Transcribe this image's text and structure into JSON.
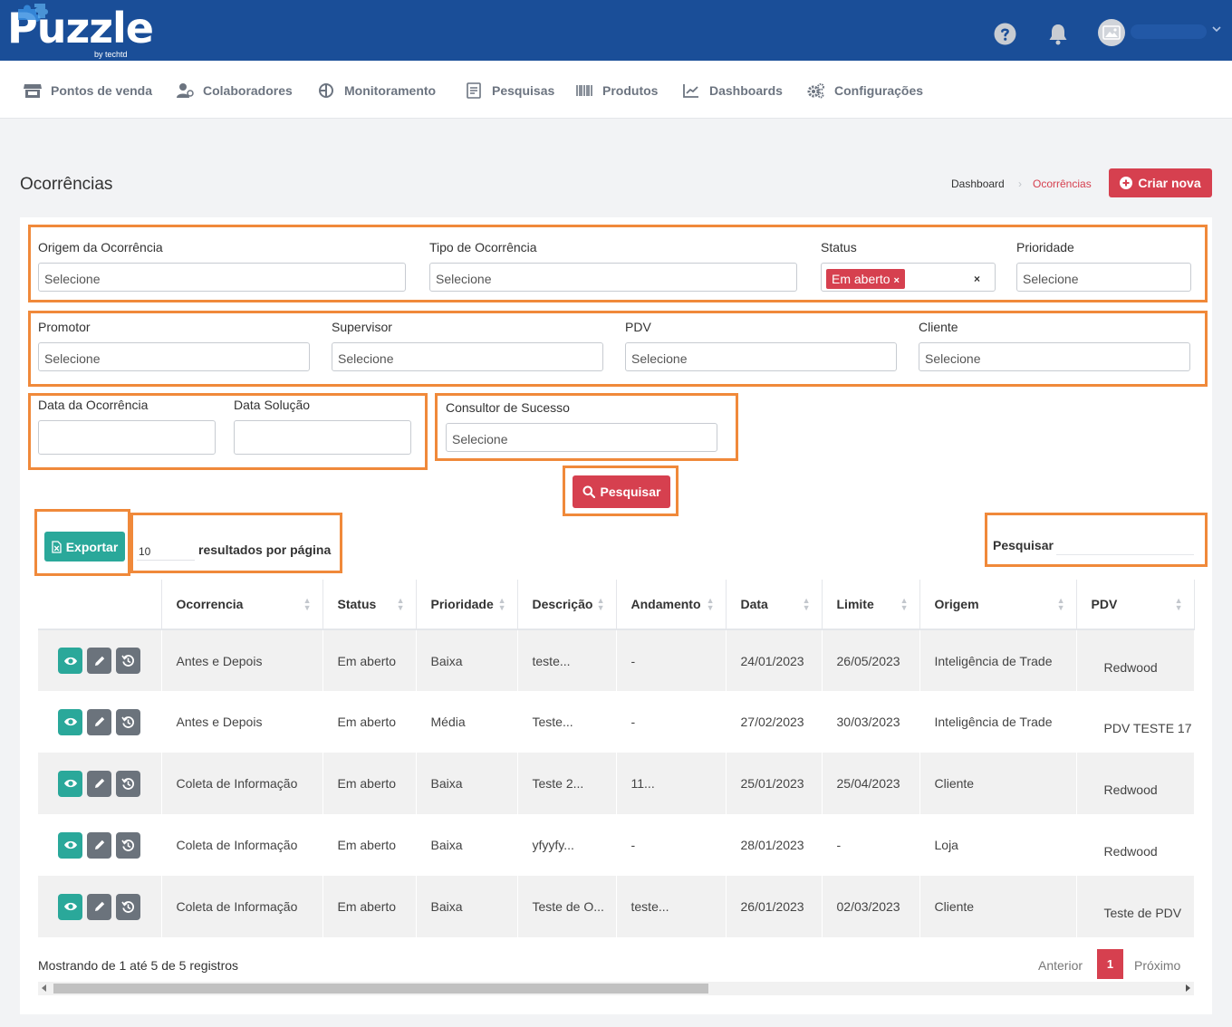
{
  "brand": {
    "name": "Puzzle",
    "sub": "by techtd"
  },
  "nav": [
    {
      "label": "Pontos de venda",
      "icon": "store-icon"
    },
    {
      "label": "Colaboradores",
      "icon": "users-icon"
    },
    {
      "label": "Monitoramento",
      "icon": "monitor-icon"
    },
    {
      "label": "Pesquisas",
      "icon": "survey-icon"
    },
    {
      "label": "Produtos",
      "icon": "barcode-icon"
    },
    {
      "label": "Dashboards",
      "icon": "chart-icon"
    },
    {
      "label": "Configurações",
      "icon": "cogs-icon"
    }
  ],
  "page": {
    "title": "Ocorrências",
    "breadcrumb": {
      "home": "Dashboard",
      "current": "Ocorrências"
    },
    "new_button": "Criar nova"
  },
  "filters": {
    "origem": {
      "label": "Origem da Ocorrência",
      "placeholder": "Selecione"
    },
    "tipo": {
      "label": "Tipo de Ocorrência",
      "placeholder": "Selecione"
    },
    "status": {
      "label": "Status",
      "tag": "Em aberto",
      "tag_remove": "×",
      "clear": "×"
    },
    "prioridade": {
      "label": "Prioridade",
      "placeholder": "Selecione"
    },
    "promotor": {
      "label": "Promotor",
      "placeholder": "Selecione"
    },
    "supervisor": {
      "label": "Supervisor",
      "placeholder": "Selecione"
    },
    "pdv": {
      "label": "PDV",
      "placeholder": "Selecione"
    },
    "cliente": {
      "label": "Cliente",
      "placeholder": "Selecione"
    },
    "data_ocorrencia": {
      "label": "Data da Ocorrência"
    },
    "data_solucao": {
      "label": "Data Solução"
    },
    "consultor": {
      "label": "Consultor de Sucesso",
      "placeholder": "Selecione"
    },
    "search_button": "Pesquisar"
  },
  "toolbar": {
    "export_button": "Exportar",
    "per_page": "10",
    "per_page_label": "resultados por página",
    "search_label": "Pesquisar"
  },
  "table": {
    "columns": [
      "Ocorrencia",
      "Status",
      "Prioridade",
      "Descrição",
      "Andamento",
      "Data",
      "Limite",
      "Origem",
      "PDV"
    ],
    "rows": [
      {
        "ocorrencia": "Antes e Depois",
        "status": "Em aberto",
        "prioridade": "Baixa",
        "descricao": "teste...",
        "andamento": "-",
        "data": "24/01/2023",
        "limite": "26/05/2023",
        "origem": "Inteligência de Trade",
        "pdv": "Redwood"
      },
      {
        "ocorrencia": "Antes e Depois",
        "status": "Em aberto",
        "prioridade": "Média",
        "descricao": "Teste...",
        "andamento": "-",
        "data": "27/02/2023",
        "limite": "30/03/2023",
        "origem": "Inteligência de Trade",
        "pdv": "PDV TESTE 17"
      },
      {
        "ocorrencia": "Coleta de Informação",
        "status": "Em aberto",
        "prioridade": "Baixa",
        "descricao": "Teste 2...",
        "andamento": "11...",
        "data": "25/01/2023",
        "limite": "25/04/2023",
        "origem": "Cliente",
        "pdv": "Redwood"
      },
      {
        "ocorrencia": "Coleta de Informação",
        "status": "Em aberto",
        "prioridade": "Baixa",
        "descricao": "yfyyfy...",
        "andamento": "-",
        "data": "28/01/2023",
        "limite": "-",
        "origem": "Loja",
        "pdv": "Redwood"
      },
      {
        "ocorrencia": "Coleta de Informação",
        "status": "Em aberto",
        "prioridade": "Baixa",
        "descricao": "Teste de O...",
        "andamento": "teste...",
        "data": "26/01/2023",
        "limite": "02/03/2023",
        "origem": "Cliente",
        "pdv": "Teste de PDV"
      }
    ]
  },
  "footer": {
    "info": "Mostrando de 1 até 5 de 5 registros",
    "prev": "Anterior",
    "current_page": "1",
    "next": "Próximo"
  },
  "colors": {
    "header": "#1a4e98",
    "accent": "#d6404f",
    "teal": "#2aa89a",
    "highlight": "#f0893a"
  }
}
